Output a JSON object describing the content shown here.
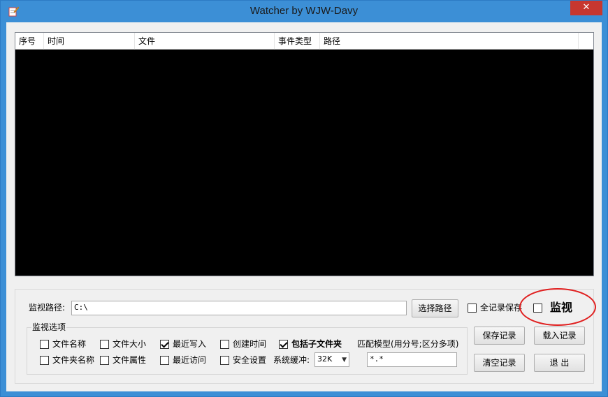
{
  "window": {
    "title": "Watcher by WJW-Davy",
    "close_glyph": "✕",
    "app_icon": "notepad-pencil-icon",
    "accent_color": "#3c8fd6",
    "close_color": "#c7372f"
  },
  "listview": {
    "columns": [
      "序号",
      "时间",
      "文件",
      "事件类型",
      "路径"
    ]
  },
  "path": {
    "label": "监视路径:",
    "value": "C:\\",
    "browse_button": "选择路径"
  },
  "full_save": {
    "label": "全记录保存",
    "checked": false
  },
  "monitor": {
    "label": "监视",
    "checked": false
  },
  "options": {
    "group_title": "监视选项",
    "file_name": "文件名称",
    "file_size": "文件大小",
    "last_write": "最近写入",
    "creation_time": "创建时间",
    "include_subdirs": "包括子文件夹",
    "dir_name": "文件夹名称",
    "attributes": "文件属性",
    "last_access": "最近访问",
    "security": "安全设置",
    "buffer_label": "系统缓冲:",
    "buffer_value": "32K",
    "pattern_label": "匹配模型(用分号;区分多项)",
    "pattern_value": "*.*"
  },
  "buttons": {
    "save_log": "保存记录",
    "load_log": "载入记录",
    "clear_log": "清空记录",
    "exit": "退 出"
  }
}
